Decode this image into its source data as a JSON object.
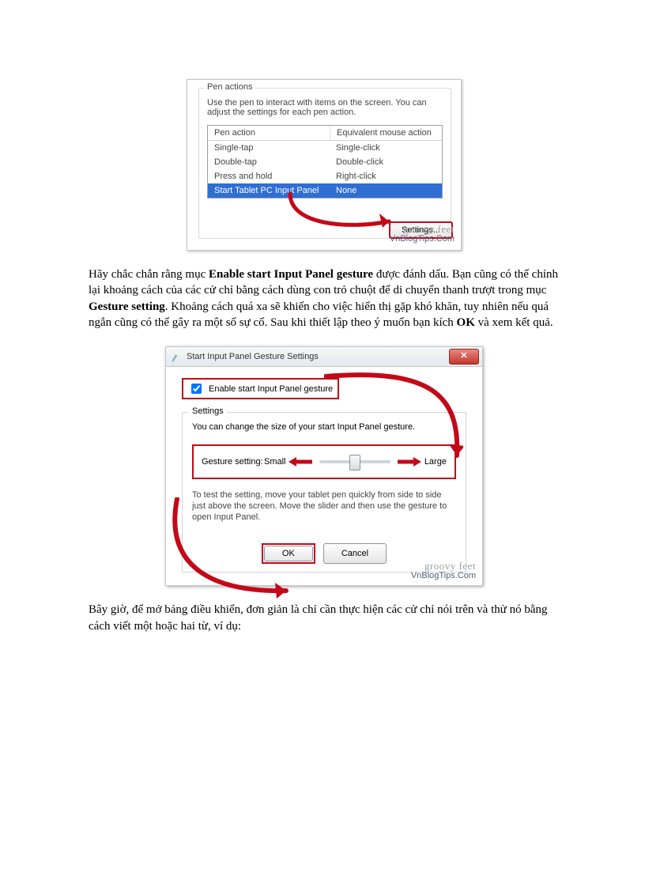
{
  "fig1": {
    "group_title": "Pen actions",
    "group_desc": "Use the pen to interact with items on the screen.  You can adjust the settings for each pen action.",
    "col_action": "Pen action",
    "col_mouse": "Equivalent mouse action",
    "rows": [
      {
        "a": "Single-tap",
        "m": "Single-click"
      },
      {
        "a": "Double-tap",
        "m": "Double-click"
      },
      {
        "a": "Press and hold",
        "m": "Right-click"
      },
      {
        "a": "Start Tablet PC Input Panel",
        "m": "None"
      }
    ],
    "settings_btn": "Settings...",
    "wm1": "groovy feet",
    "wm2": "VnBlogTips.Com"
  },
  "para1": {
    "t1": "Hãy chắc chắn rằng mục ",
    "b1": "Enable start Input Panel gesture",
    "t2": " được đánh dấu. Bạn cũng có thể chỉnh lại khoảng cách của các cử chỉ bằng cách dùng con trỏ chuột để di chuyển thanh trượt trong mục ",
    "b2": "Gesture setting",
    "t3": ". Khoảng cách quá xa sẽ khiến cho việc hiển thị gặp khó khăn, tuy nhiên nếu quá ngắn cũng có thể gây ra một số sự cố. Sau khi thiết lập theo ý muốn bạn kích ",
    "b3": "OK",
    "t4": " và xem kết quả."
  },
  "fig2": {
    "title": "Start Input Panel Gesture Settings",
    "close_glyph": "✕",
    "enable_label": "Enable start Input Panel gesture",
    "group_title": "Settings",
    "group_desc": "You can change the size of your start Input Panel gesture.",
    "gslabel": "Gesture setting:",
    "small": "Small",
    "large": "Large",
    "help": "To test the setting, move your tablet pen quickly from side to side just above the screen.  Move the slider and then use the gesture to open Input Panel.",
    "ok": "OK",
    "cancel": "Cancel",
    "wm1": "groovy feet",
    "wm2": "VnBlogTips.Com"
  },
  "para2": "Bây giờ, để mở bảng điều khiển, đơn giản là chỉ cần thực hiện các cử chỉ nói trên và thử nó bằng cách viết một hoặc hai từ, ví dụ:"
}
